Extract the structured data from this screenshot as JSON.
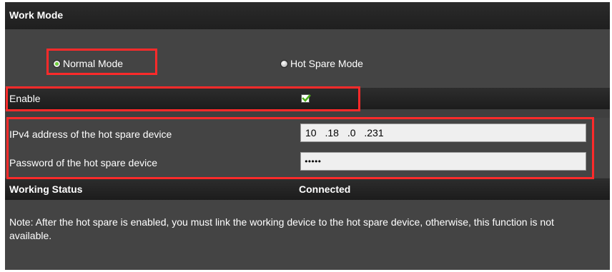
{
  "section": {
    "title": "Work Mode"
  },
  "mode": {
    "options": [
      {
        "label": "Normal Mode",
        "selected": true
      },
      {
        "label": "Hot Spare Mode",
        "selected": false
      }
    ]
  },
  "enable": {
    "label": "Enable",
    "checked": true
  },
  "fields": {
    "ip_label": "IPv4 address of the hot spare device",
    "ip_value": "10 .18 .0 .231",
    "password_label": "Password of the hot spare device",
    "password_value": "•••••"
  },
  "status": {
    "label": "Working Status",
    "value": "Connected"
  },
  "note": "Note: After the hot spare is enabled, you must link the working device to the hot spare device, otherwise, this function is not available.",
  "colors": {
    "highlight": "#ff2a2a",
    "panel_bg": "#444444",
    "bar_bg": "#1f1f1f",
    "check_green": "#4caf1a"
  },
  "icons": {
    "radio_selected": "radio-selected-icon",
    "radio_unselected": "radio-unselected-icon",
    "checkbox_checked": "checkbox-checked-icon"
  }
}
